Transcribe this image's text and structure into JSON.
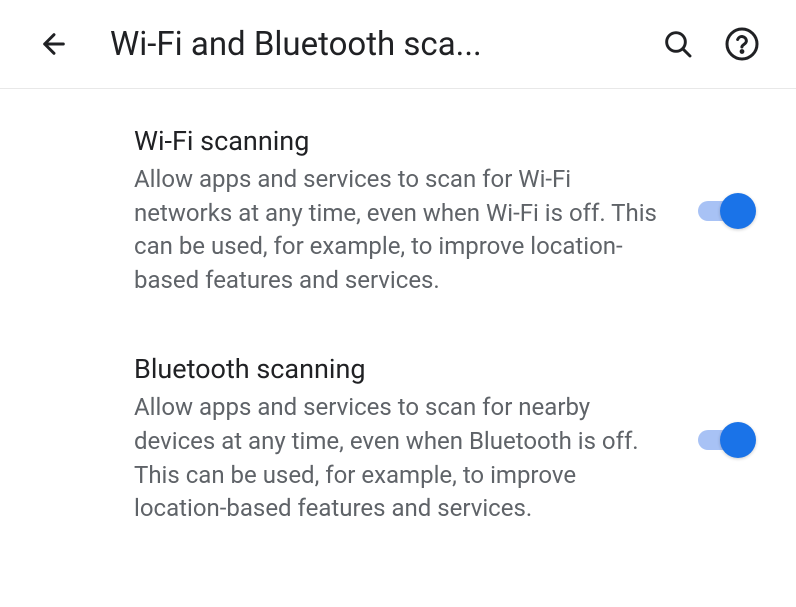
{
  "header": {
    "title": "Wi-Fi and Bluetooth sca..."
  },
  "settings": [
    {
      "title": "Wi-Fi scanning",
      "description": "Allow apps and services to scan for Wi-Fi networks at any time, even when Wi-Fi is off. This can be used, for example, to improve location-based features and services.",
      "enabled": true
    },
    {
      "title": "Bluetooth scanning",
      "description": "Allow apps and services to scan for nearby devices at any time, even when Bluetooth is off. This can be used, for example, to improve location-based features and services.",
      "enabled": true
    }
  ]
}
